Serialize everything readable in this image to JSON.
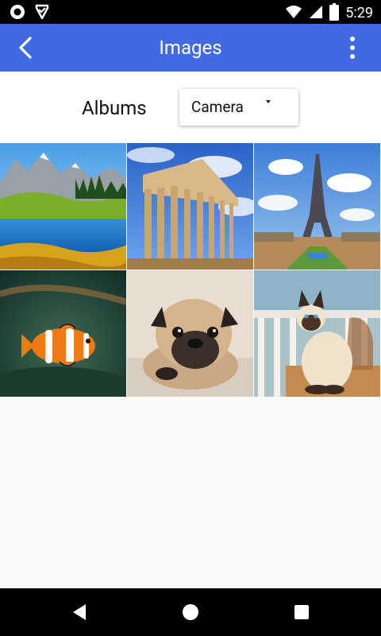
{
  "status_bar": {
    "time": "5:29",
    "icons": [
      "record-icon",
      "download-check-icon",
      "signal-icon",
      "wifi-icon",
      "battery-icon"
    ]
  },
  "app_bar": {
    "title": "Images",
    "back_icon": "chevron-left-icon",
    "menu_icon": "more-vert-icon",
    "color": "#4169e1"
  },
  "albums": {
    "label": "Albums",
    "selected": "Camera"
  },
  "grid": {
    "images": [
      {
        "subject": "mountain-lake"
      },
      {
        "subject": "parthenon"
      },
      {
        "subject": "eiffel-tower"
      },
      {
        "subject": "clownfish"
      },
      {
        "subject": "pug"
      },
      {
        "subject": "siamese-cat"
      }
    ]
  },
  "nav_bar": {
    "icons": [
      "back-triangle-icon",
      "home-circle-icon",
      "recents-square-icon"
    ]
  }
}
